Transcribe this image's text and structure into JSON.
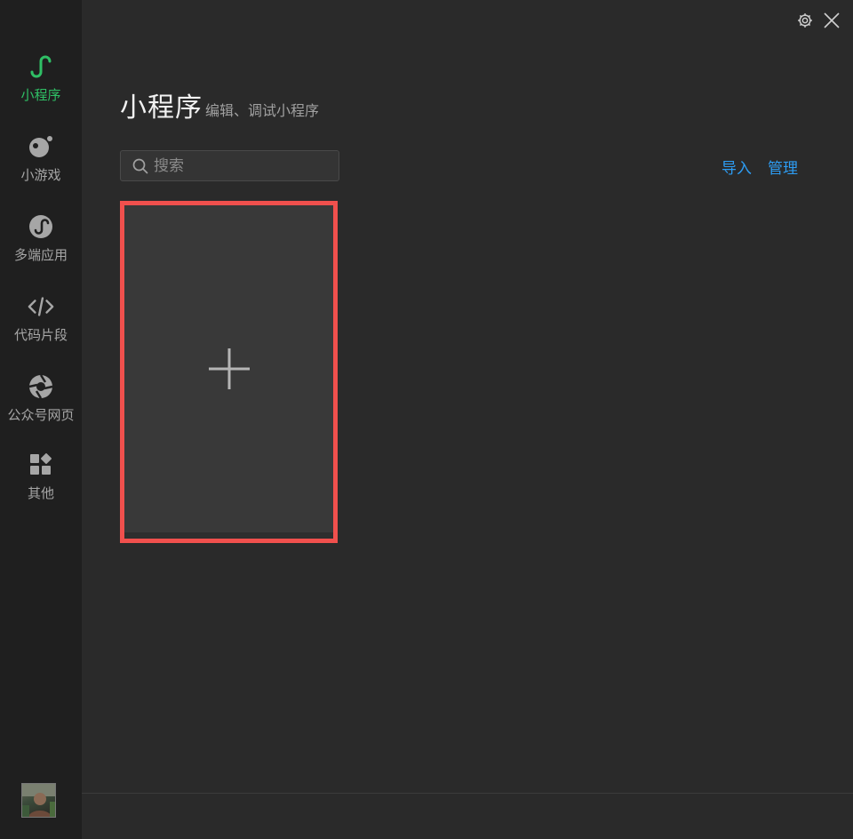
{
  "sidebar": {
    "items": [
      {
        "label": "小程序",
        "icon": "miniprogram-icon",
        "active": true
      },
      {
        "label": "小游戏",
        "icon": "minigame-icon"
      },
      {
        "label": "多端应用",
        "icon": "multiplatform-icon"
      },
      {
        "label": "代码片段",
        "icon": "code-snippet-icon"
      },
      {
        "label": "公众号网页",
        "icon": "official-account-icon"
      },
      {
        "label": "其他",
        "icon": "other-icon"
      }
    ]
  },
  "header": {
    "title": "小程序",
    "subtitle": "编辑、调试小程序"
  },
  "search": {
    "placeholder": "搜索"
  },
  "actions": {
    "import_label": "导入",
    "manage_label": "管理"
  },
  "colors": {
    "active_green": "#2fbf65",
    "link_blue": "#2d9cf2",
    "highlight_red": "#f0504d",
    "background": "#2a2a2a",
    "sidebar_bg": "#1f1f1f"
  }
}
